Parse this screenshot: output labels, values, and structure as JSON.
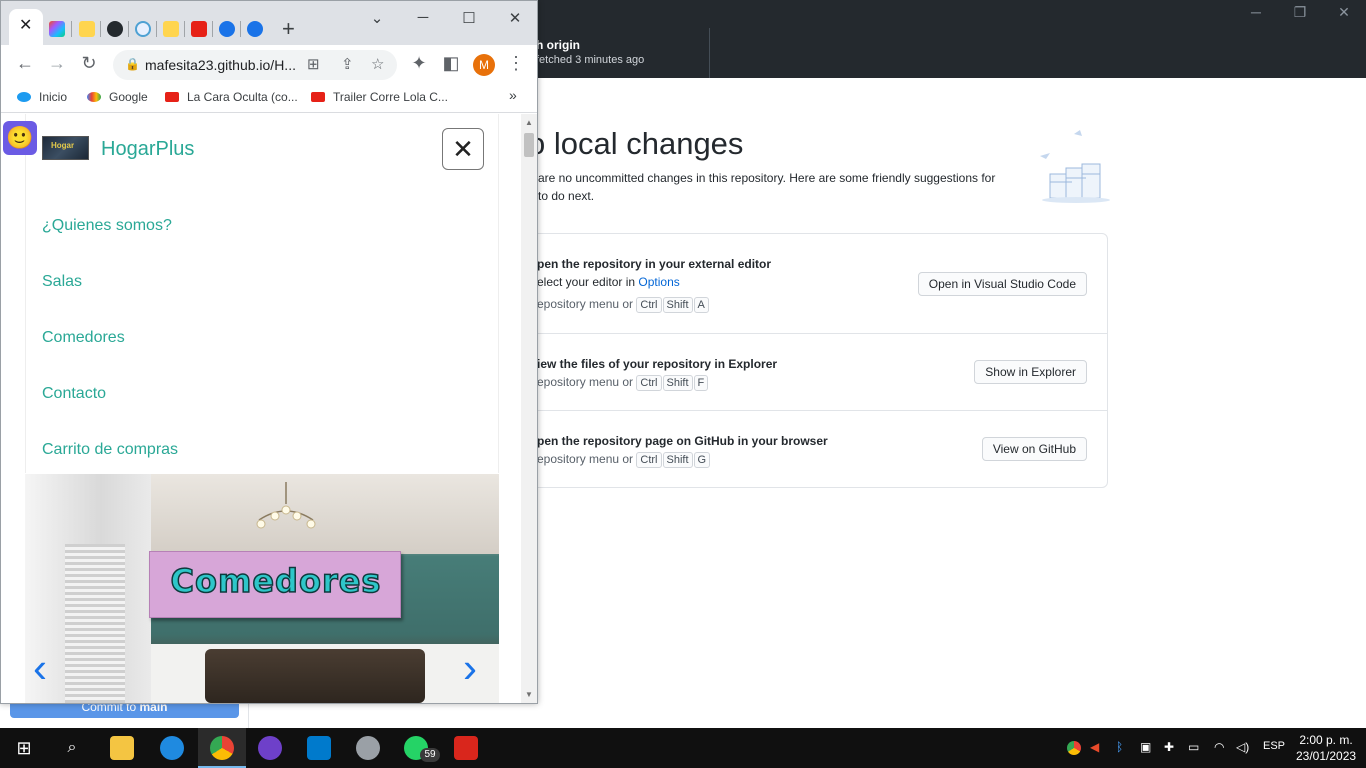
{
  "github": {
    "fetch_title": "h origin",
    "fetch_sub": "fetched 3 minutes ago",
    "no_local_title": "o local changes",
    "description": "are no uncommitted changes in this repository. Here are some friendly suggestions for to do next.",
    "commit_prefix": "Commit to",
    "commit_branch": "main",
    "rows": [
      {
        "title": "pen the repository in your external editor",
        "sub_text": "elect your editor in",
        "sub_link": "Options",
        "kbd_prefix": "epository menu or",
        "keys": [
          "Ctrl",
          "Shift",
          "A"
        ],
        "button": "Open in Visual Studio Code"
      },
      {
        "title": "iew the files of your repository in Explorer",
        "kbd_prefix": "epository menu or",
        "keys": [
          "Ctrl",
          "Shift",
          "F"
        ],
        "button": "Show in Explorer"
      },
      {
        "title": "pen the repository page on GitHub in your browser",
        "kbd_prefix": "epository menu or",
        "keys": [
          "Ctrl",
          "Shift",
          "G"
        ],
        "button": "View on GitHub"
      }
    ]
  },
  "chrome": {
    "url": "mafesita23.github.io/H...",
    "profile_initial": "M",
    "bookmarks": [
      "Inicio",
      "Google",
      "La Cara Oculta (co...",
      "Trailer Corre Lola C..."
    ],
    "more_bookmarks": "»"
  },
  "site": {
    "brand": "HogarPlus",
    "logo_text": "Hogar",
    "close_glyph": "✕",
    "menu": [
      "¿Quienes somos?",
      "Salas",
      "Comedores",
      "Contacto",
      "Carrito de compras"
    ],
    "banner": "Comedores",
    "prev_glyph": "‹",
    "next_glyph": "›"
  },
  "taskbar": {
    "language": "ESP",
    "time": "2:00 p. m.",
    "date": "23/01/2023",
    "whatsapp_badge": "59"
  },
  "colors": {
    "accent_teal": "#2aa896",
    "github_dark": "#24292e",
    "chrome_tabbar": "#dee1e6",
    "commit_blue": "#5a96e8"
  }
}
